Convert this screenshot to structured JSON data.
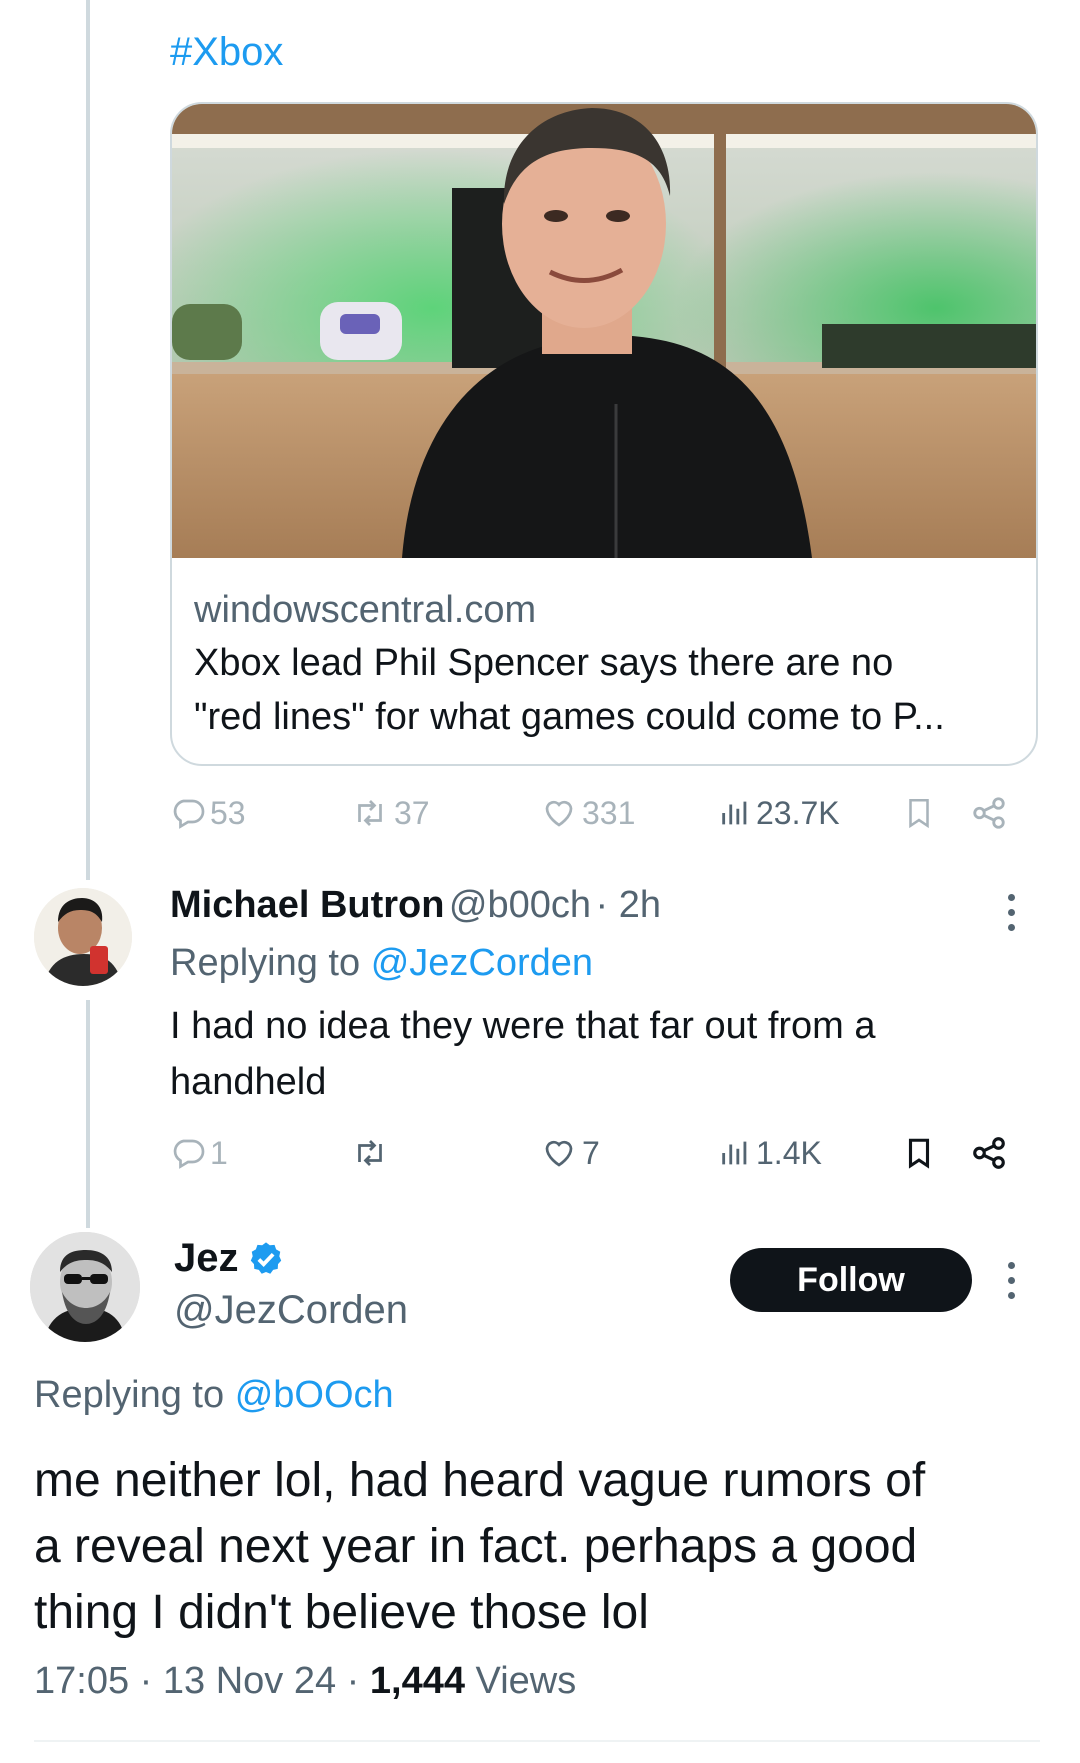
{
  "quoted_post": {
    "hashtag": "#Xbox",
    "card": {
      "domain": "windowscentral.com",
      "title_line1": "Xbox lead Phil Spencer says there are no",
      "title_line2": "\"red lines\" for what games could come to P..."
    },
    "stats": {
      "replies": "53",
      "reposts": "37",
      "likes": "331",
      "views": "23.7K"
    }
  },
  "reply": {
    "display_name": "Michael Butron",
    "handle": "@b00ch",
    "time": "· 2h",
    "replying_prefix": "Replying to",
    "replying_to": "@JezCorden",
    "text_line1": "I had no idea they were that far out from a",
    "text_line2": "handheld",
    "stats": {
      "replies": "1",
      "reposts": "",
      "likes": "7",
      "views": "1.4K"
    }
  },
  "main_post": {
    "display_name": "Jez",
    "handle": "@JezCorden",
    "follow_label": "Follow",
    "replying_prefix": "Replying to",
    "replying_to": "@bOOch",
    "text_line1": "me neither lol, had heard vague rumors of",
    "text_line2": "a reveal next year in fact. perhaps a good",
    "text_line3": "thing I didn't believe those lol",
    "time": "17:05",
    "date": "13 Nov 24",
    "views_count": "1,444",
    "views_label": "Views"
  },
  "colors": {
    "accent": "#1d9bf0",
    "text": "#0f1419",
    "secondary": "#536471",
    "verified": "#1d9bf0"
  }
}
